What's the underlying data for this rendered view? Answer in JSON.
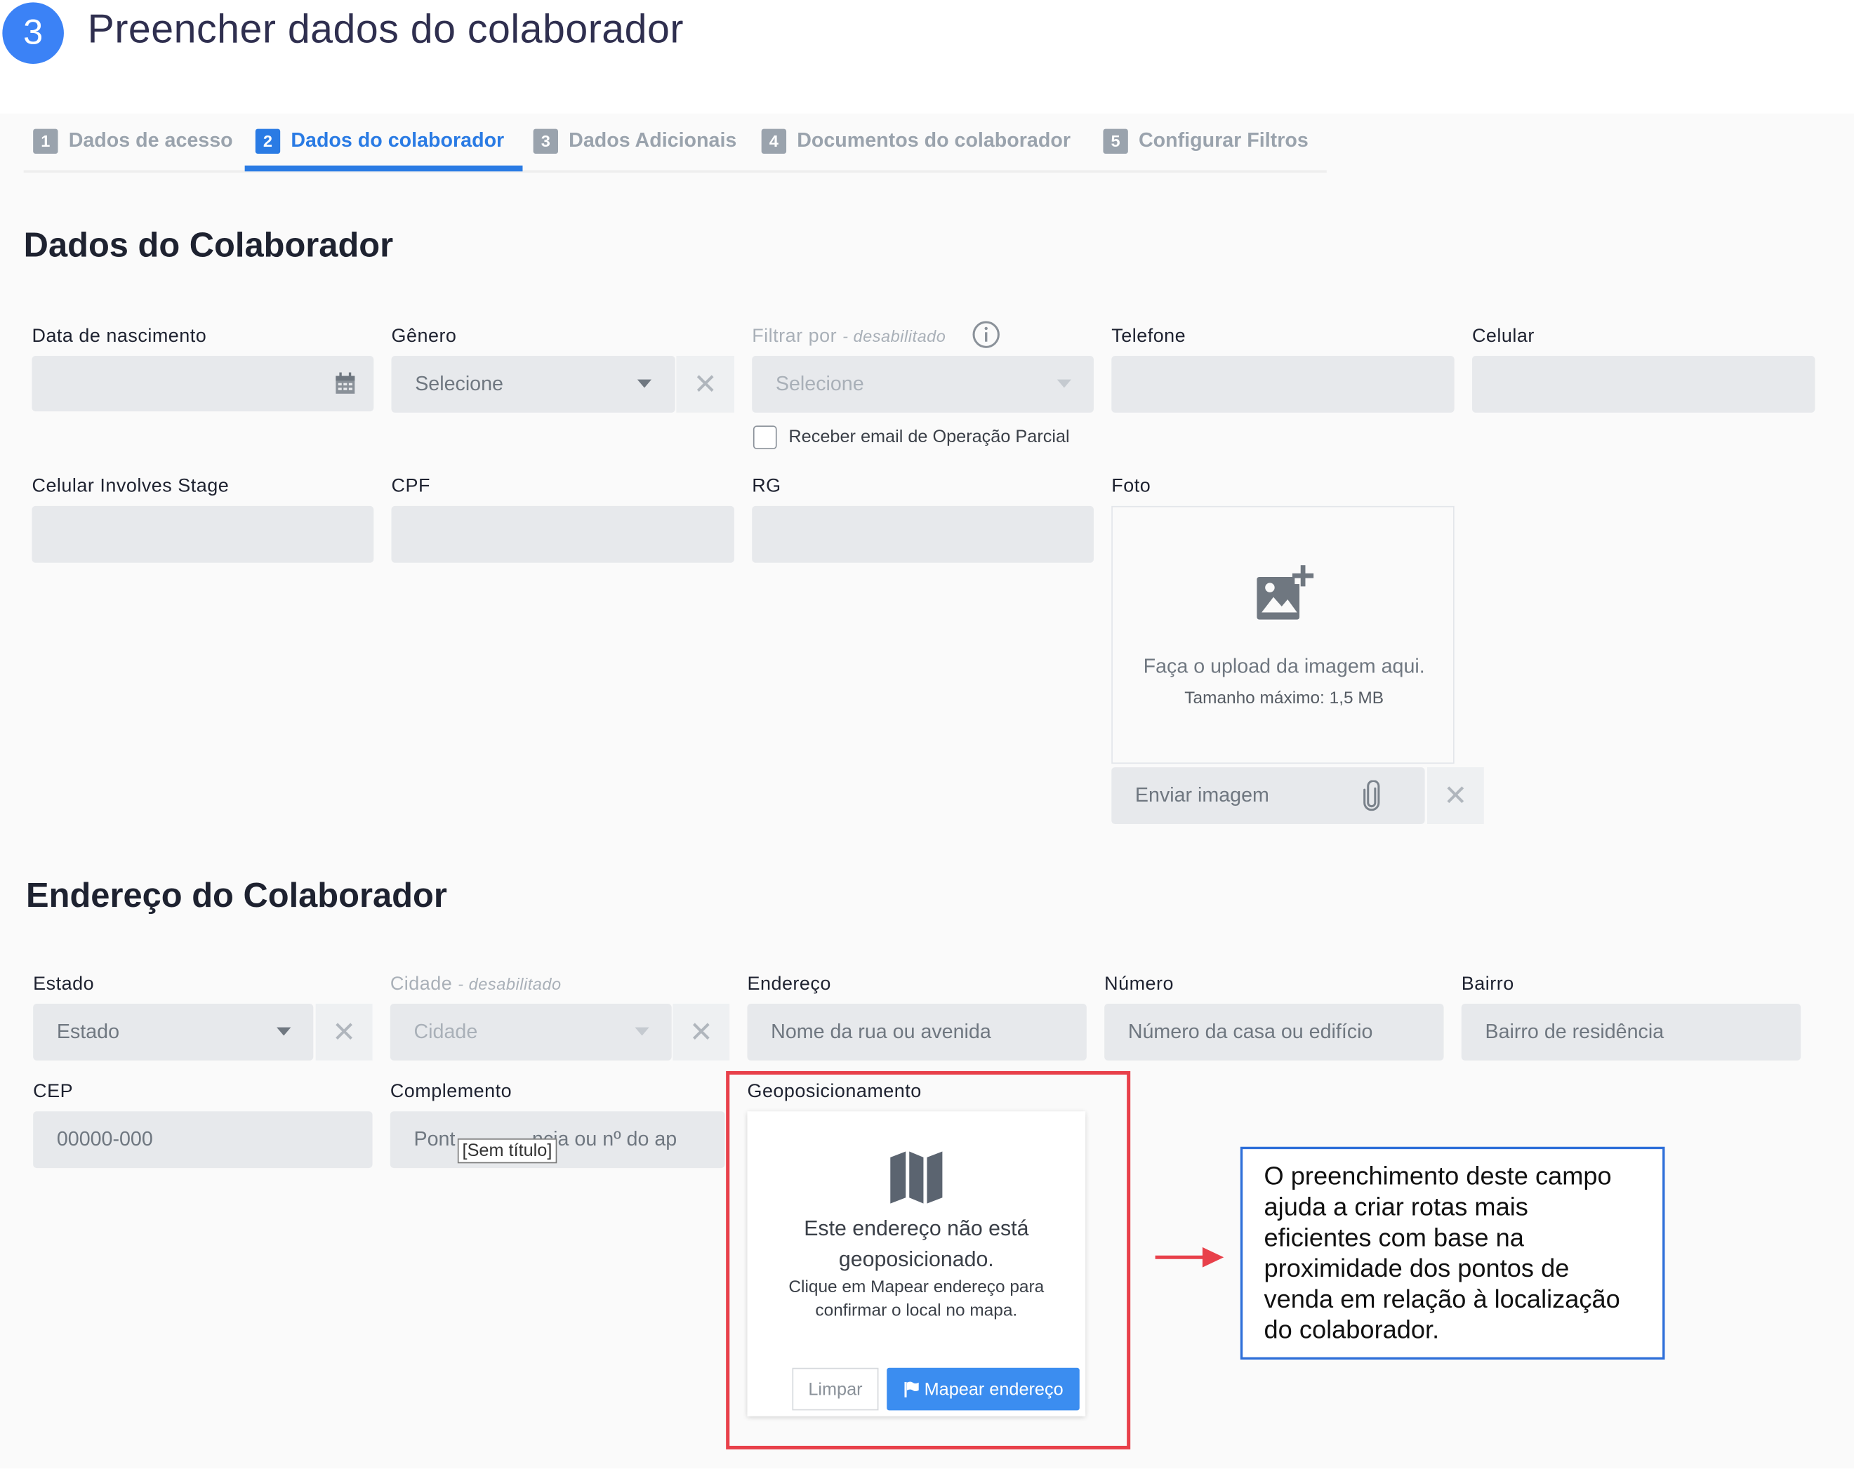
{
  "step": {
    "number": "3",
    "title": "Preencher dados do colaborador"
  },
  "tabs": [
    {
      "num": "1",
      "label": "Dados de acesso"
    },
    {
      "num": "2",
      "label": "Dados do colaborador"
    },
    {
      "num": "3",
      "label": "Dados Adicionais"
    },
    {
      "num": "4",
      "label": "Documentos do colaborador"
    },
    {
      "num": "5",
      "label": "Configurar Filtros"
    }
  ],
  "colab": {
    "heading": "Dados do Colaborador",
    "data_nascimento_label": "Data de nascimento",
    "genero_label": "Gênero",
    "genero_value": "Selecione",
    "filtrar_label": "Filtrar por",
    "filtrar_note": "- desabilitado",
    "filtrar_value": "Selecione",
    "receber_email_label": "Receber email de Operação Parcial",
    "telefone_label": "Telefone",
    "celular_label": "Celular",
    "celular_stage_label": "Celular Involves Stage",
    "cpf_label": "CPF",
    "rg_label": "RG",
    "foto_label": "Foto",
    "upload_text": "Faça o upload da imagem aqui.",
    "upload_size": "Tamanho máximo: 1,5 MB",
    "enviar_imagem": "Enviar imagem"
  },
  "endereco": {
    "heading": "Endereço do Colaborador",
    "estado_label": "Estado",
    "estado_value": "Estado",
    "cidade_label": "Cidade",
    "cidade_note": "- desabilitado",
    "cidade_value": "Cidade",
    "endereco_label": "Endereço",
    "endereco_placeholder": "Nome da rua ou avenida",
    "numero_label": "Número",
    "numero_placeholder": "Número da casa ou edifício",
    "bairro_label": "Bairro",
    "bairro_placeholder": "Bairro de residência",
    "cep_label": "CEP",
    "cep_placeholder": "00000-000",
    "complemento_label": "Complemento",
    "complemento_placeholder_start": "Pont",
    "complemento_placeholder_end": "ncia ou nº do ap",
    "tooltip": "[Sem título]",
    "geo_label": "Geoposicionamento",
    "geo_title": "Este endereço não está geoposicionado.",
    "geo_text": "Clique em Mapear endereço para confirmar o local no mapa.",
    "limpar": "Limpar",
    "mapear": "Mapear endereço"
  },
  "annotation": "O preenchimento deste campo ajuda a criar rotas mais eficientes com base na proximidade dos pontos de venda em relação à localização do colaborador.",
  "colors": {
    "accent": "#2a7be4",
    "step": "#3b82f6",
    "highlight": "#e8404a",
    "note_border": "#2e6fd9"
  },
  "icons": [
    "calendar-icon",
    "chevron-down-icon",
    "close-icon",
    "info-icon",
    "add-photo-icon",
    "paperclip-icon",
    "map-icon",
    "flag-icon",
    "arrow-right-icon"
  ]
}
